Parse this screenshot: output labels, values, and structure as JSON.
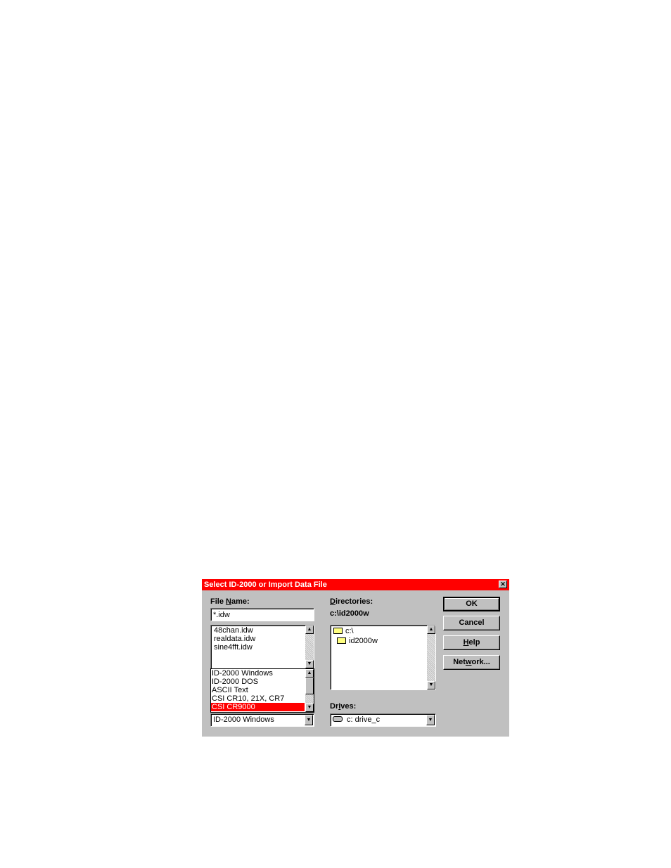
{
  "dialog": {
    "title": "Select ID-2000 or Import Data File",
    "close_glyph": "✕"
  },
  "file_name": {
    "label_pre": "File ",
    "label_u": "N",
    "label_post": "ame:",
    "value": "*.idw",
    "files": [
      "48chan.idw",
      "realdata.idw",
      "sine4fft.idw"
    ]
  },
  "file_types": {
    "items": [
      "ID-2000 Windows",
      "ID-2000 DOS",
      "ASCII Text",
      "CSI CR10, 21X, CR7",
      "CSI CR9000"
    ],
    "selected_index": 4,
    "combo_value": "ID-2000 Windows"
  },
  "directories": {
    "label_u": "D",
    "label_post": "irectories:",
    "current_path": "c:\\id2000w",
    "items": [
      "c:\\",
      "id2000w"
    ]
  },
  "drives": {
    "label_pre": "Dr",
    "label_u": "i",
    "label_post": "ves:",
    "value": "c: drive_c"
  },
  "buttons": {
    "ok": "OK",
    "cancel": "Cancel",
    "help_u": "H",
    "help_post": "elp",
    "network_pre": "Net",
    "network_u": "w",
    "network_post": "ork..."
  },
  "icons": {
    "scroll_up": "▲",
    "scroll_down": "▼"
  }
}
